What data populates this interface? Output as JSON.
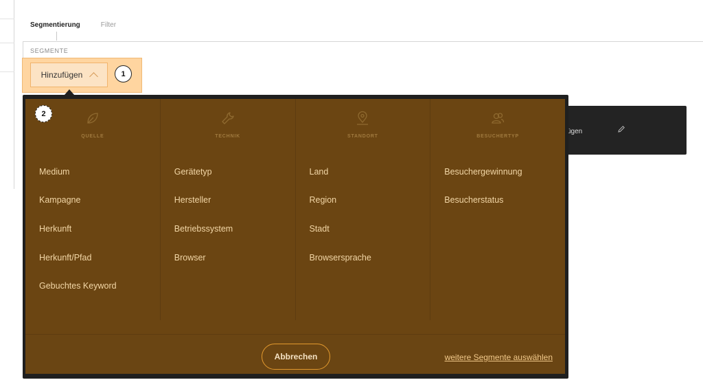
{
  "tabs": [
    {
      "label": "Segmentierung",
      "active": true
    },
    {
      "label": "Filter",
      "active": false
    }
  ],
  "section_title": "SEGMENTE",
  "add_button": {
    "label": "Hinzufügen",
    "icon": "chevron-up-icon"
  },
  "callouts": [
    "1",
    "2"
  ],
  "background_card": {
    "text": "ügen",
    "icon": "pencil-icon"
  },
  "dropdown": {
    "columns": [
      {
        "title": "QUELLE",
        "icon": "leaf-icon",
        "items": [
          "Medium",
          "Kampagne",
          "Herkunft",
          "Herkunft/Pfad",
          "Gebuchtes Keyword"
        ]
      },
      {
        "title": "TECHNIK",
        "icon": "wrench-icon",
        "items": [
          "Gerätetyp",
          "Hersteller",
          "Betriebssystem",
          "Browser"
        ]
      },
      {
        "title": "STANDORT",
        "icon": "map-pin-icon",
        "items": [
          "Land",
          "Region",
          "Stadt",
          "Browsersprache"
        ]
      },
      {
        "title": "BESUCHERTYP",
        "icon": "users-icon",
        "items": [
          "Besuchergewinnung",
          "Besucherstatus"
        ]
      }
    ],
    "cancel_label": "Abbrechen",
    "more_link": "weitere Segmente auswählen"
  },
  "colors": {
    "panel": "#6b4512",
    "panel_border": "#1f1f1f",
    "item_text": "#f2d6a6",
    "accent": "#e49a2e",
    "highlight": "#ffd5a0"
  }
}
